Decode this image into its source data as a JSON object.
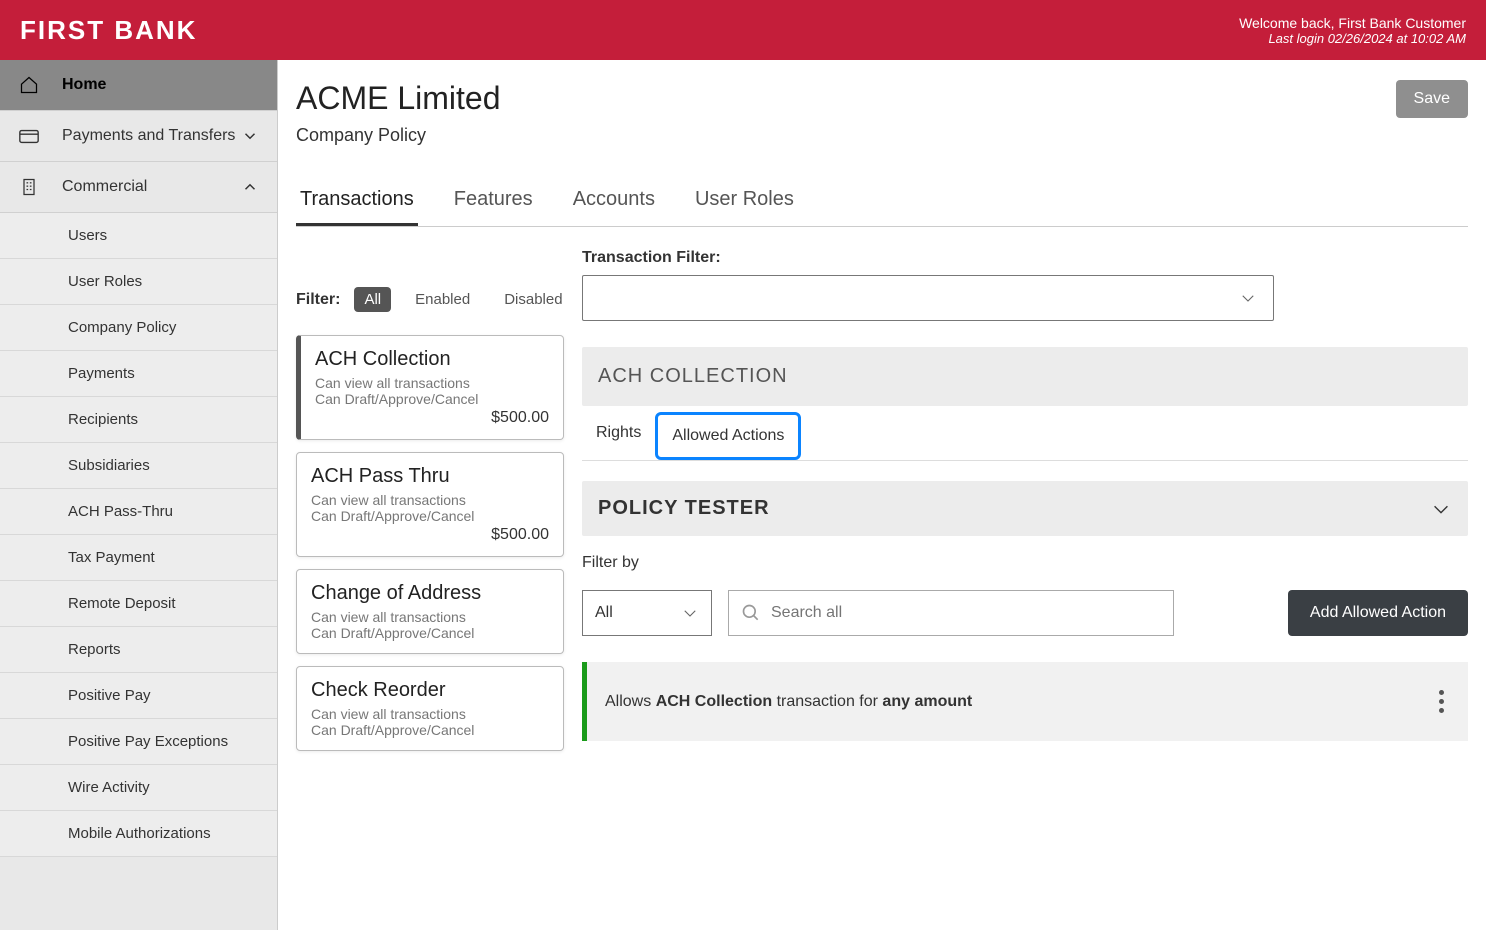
{
  "header": {
    "logo": "FIRST BANK",
    "welcome": "Welcome back, First Bank Customer",
    "last_login": "Last login 02/26/2024 at 10:02 AM"
  },
  "sidebar": {
    "home": "Home",
    "payments": "Payments and Transfers",
    "commercial": "Commercial",
    "items": [
      "Users",
      "User Roles",
      "Company Policy",
      "Payments",
      "Recipients",
      "Subsidiaries",
      "ACH Pass-Thru",
      "Tax Payment",
      "Remote Deposit",
      "Reports",
      "Positive Pay",
      "Positive Pay Exceptions",
      "Wire Activity",
      "Mobile Authorizations"
    ]
  },
  "page": {
    "title": "ACME Limited",
    "subtitle": "Company Policy",
    "save": "Save"
  },
  "tabs": [
    "Transactions",
    "Features",
    "Accounts",
    "User Roles"
  ],
  "filter": {
    "label": "Filter:",
    "options": [
      "All",
      "Enabled",
      "Disabled"
    ]
  },
  "transaction_filter": {
    "label": "Transaction Filter:",
    "value": ""
  },
  "tx_cards": [
    {
      "title": "ACH Collection",
      "l1": "Can view all transactions",
      "l2": "Can Draft/Approve/Cancel",
      "amount": "$500.00"
    },
    {
      "title": "ACH Pass Thru",
      "l1": "Can view all transactions",
      "l2": "Can Draft/Approve/Cancel",
      "amount": "$500.00"
    },
    {
      "title": "Change of Address",
      "l1": "Can view all transactions",
      "l2": "Can Draft/Approve/Cancel",
      "amount": ""
    },
    {
      "title": "Check Reorder",
      "l1": "Can view all transactions",
      "l2": "Can Draft/Approve/Cancel",
      "amount": ""
    }
  ],
  "section_title": "ACH COLLECTION",
  "sub_tabs": {
    "rights": "Rights",
    "allowed": "Allowed Actions"
  },
  "policy_tester": "POLICY TESTER",
  "filter_by": {
    "label": "Filter by",
    "select": "All",
    "search_placeholder": "Search all"
  },
  "add_action": "Add Allowed Action",
  "rule": {
    "prefix": "Allows ",
    "tx": "ACH Collection",
    "mid": " transaction for ",
    "amt": "any amount"
  }
}
